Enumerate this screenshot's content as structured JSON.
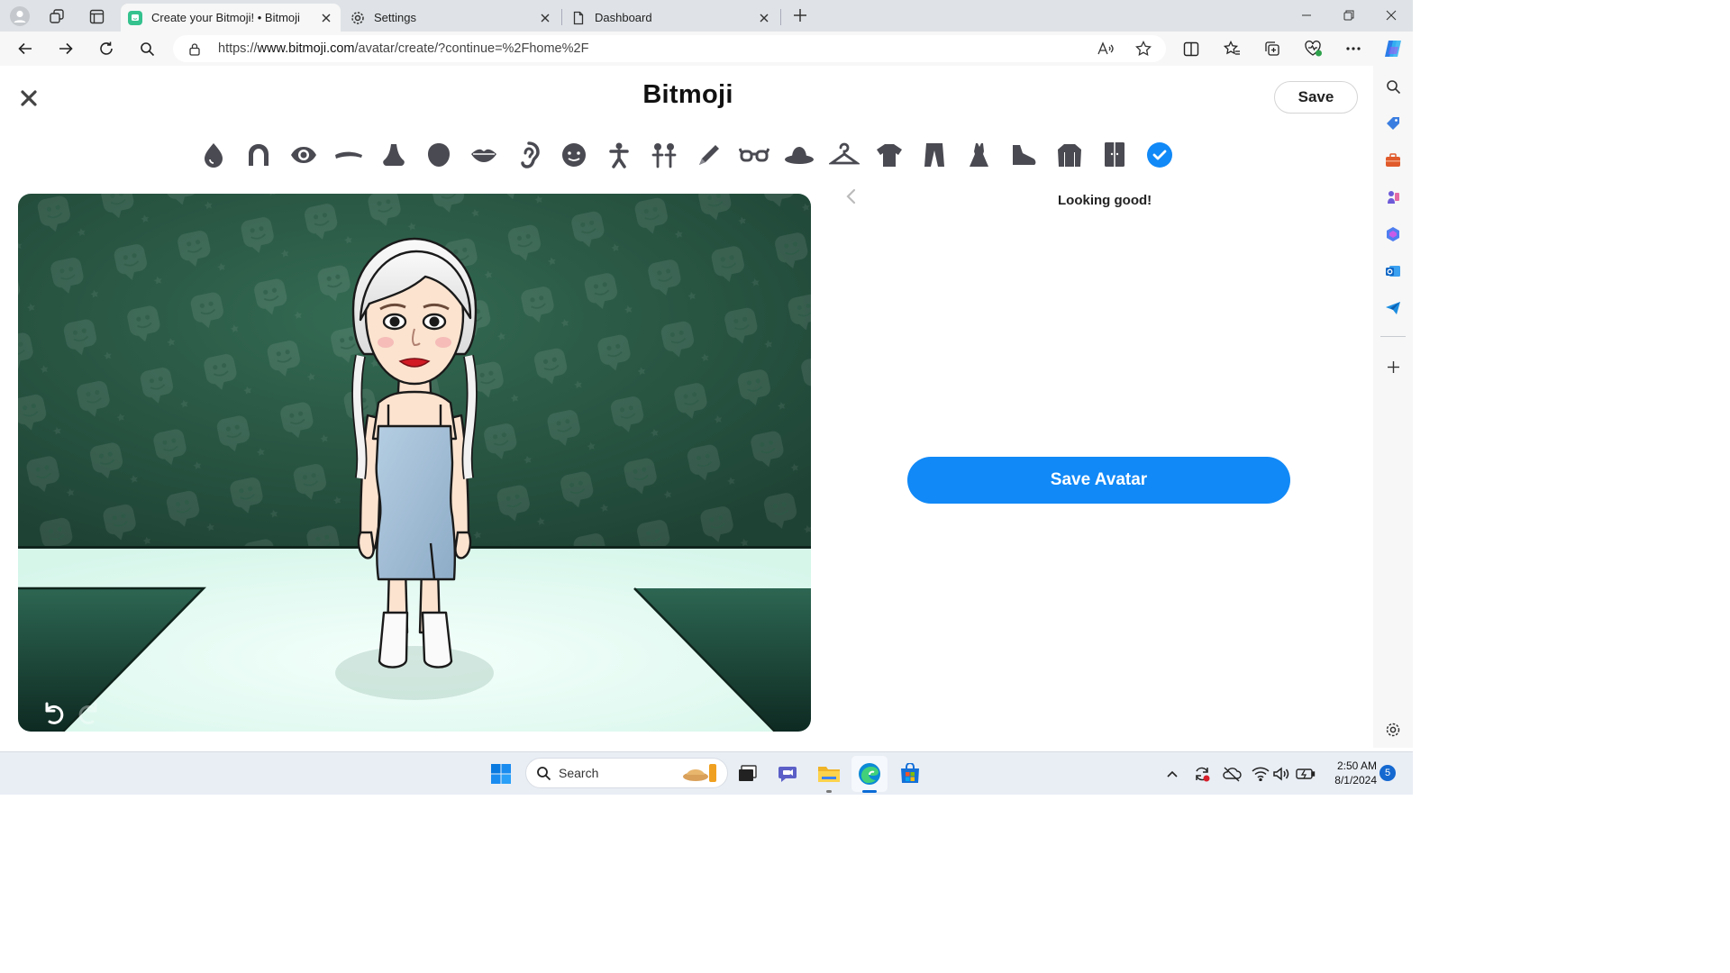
{
  "browser": {
    "tabs": [
      {
        "title": "Create your Bitmoji! • Bitmoji",
        "active": true,
        "icon": "bitmoji-icon"
      },
      {
        "title": "Settings",
        "active": false,
        "icon": "gear-icon"
      },
      {
        "title": "Dashboard",
        "active": false,
        "icon": "document-icon"
      }
    ],
    "url_prefix": "https://",
    "url_host": "www.bitmoji.com",
    "url_path": "/avatar/create/?continue=%2Fhome%2F"
  },
  "page": {
    "title": "Bitmoji",
    "save_label": "Save",
    "status_text": "Looking good!",
    "save_avatar_label": "Save Avatar",
    "categories": [
      "skin-tone",
      "hair",
      "eyes",
      "eyebrows",
      "nose",
      "face-shape",
      "lips",
      "ears",
      "face-details",
      "body",
      "pose",
      "makeup",
      "glasses",
      "hat",
      "outfit",
      "top",
      "pants",
      "dress",
      "shoes",
      "outerwear",
      "wardrobe",
      "done"
    ],
    "selected_category": "done"
  },
  "taskbar": {
    "search_placeholder": "Search",
    "time": "2:50 AM",
    "date": "8/1/2024",
    "notification_count": "5"
  },
  "colors": {
    "accent": "#1189f7",
    "stage_wall": "#2c5a46",
    "stage_floor": "#e4fbf3"
  }
}
